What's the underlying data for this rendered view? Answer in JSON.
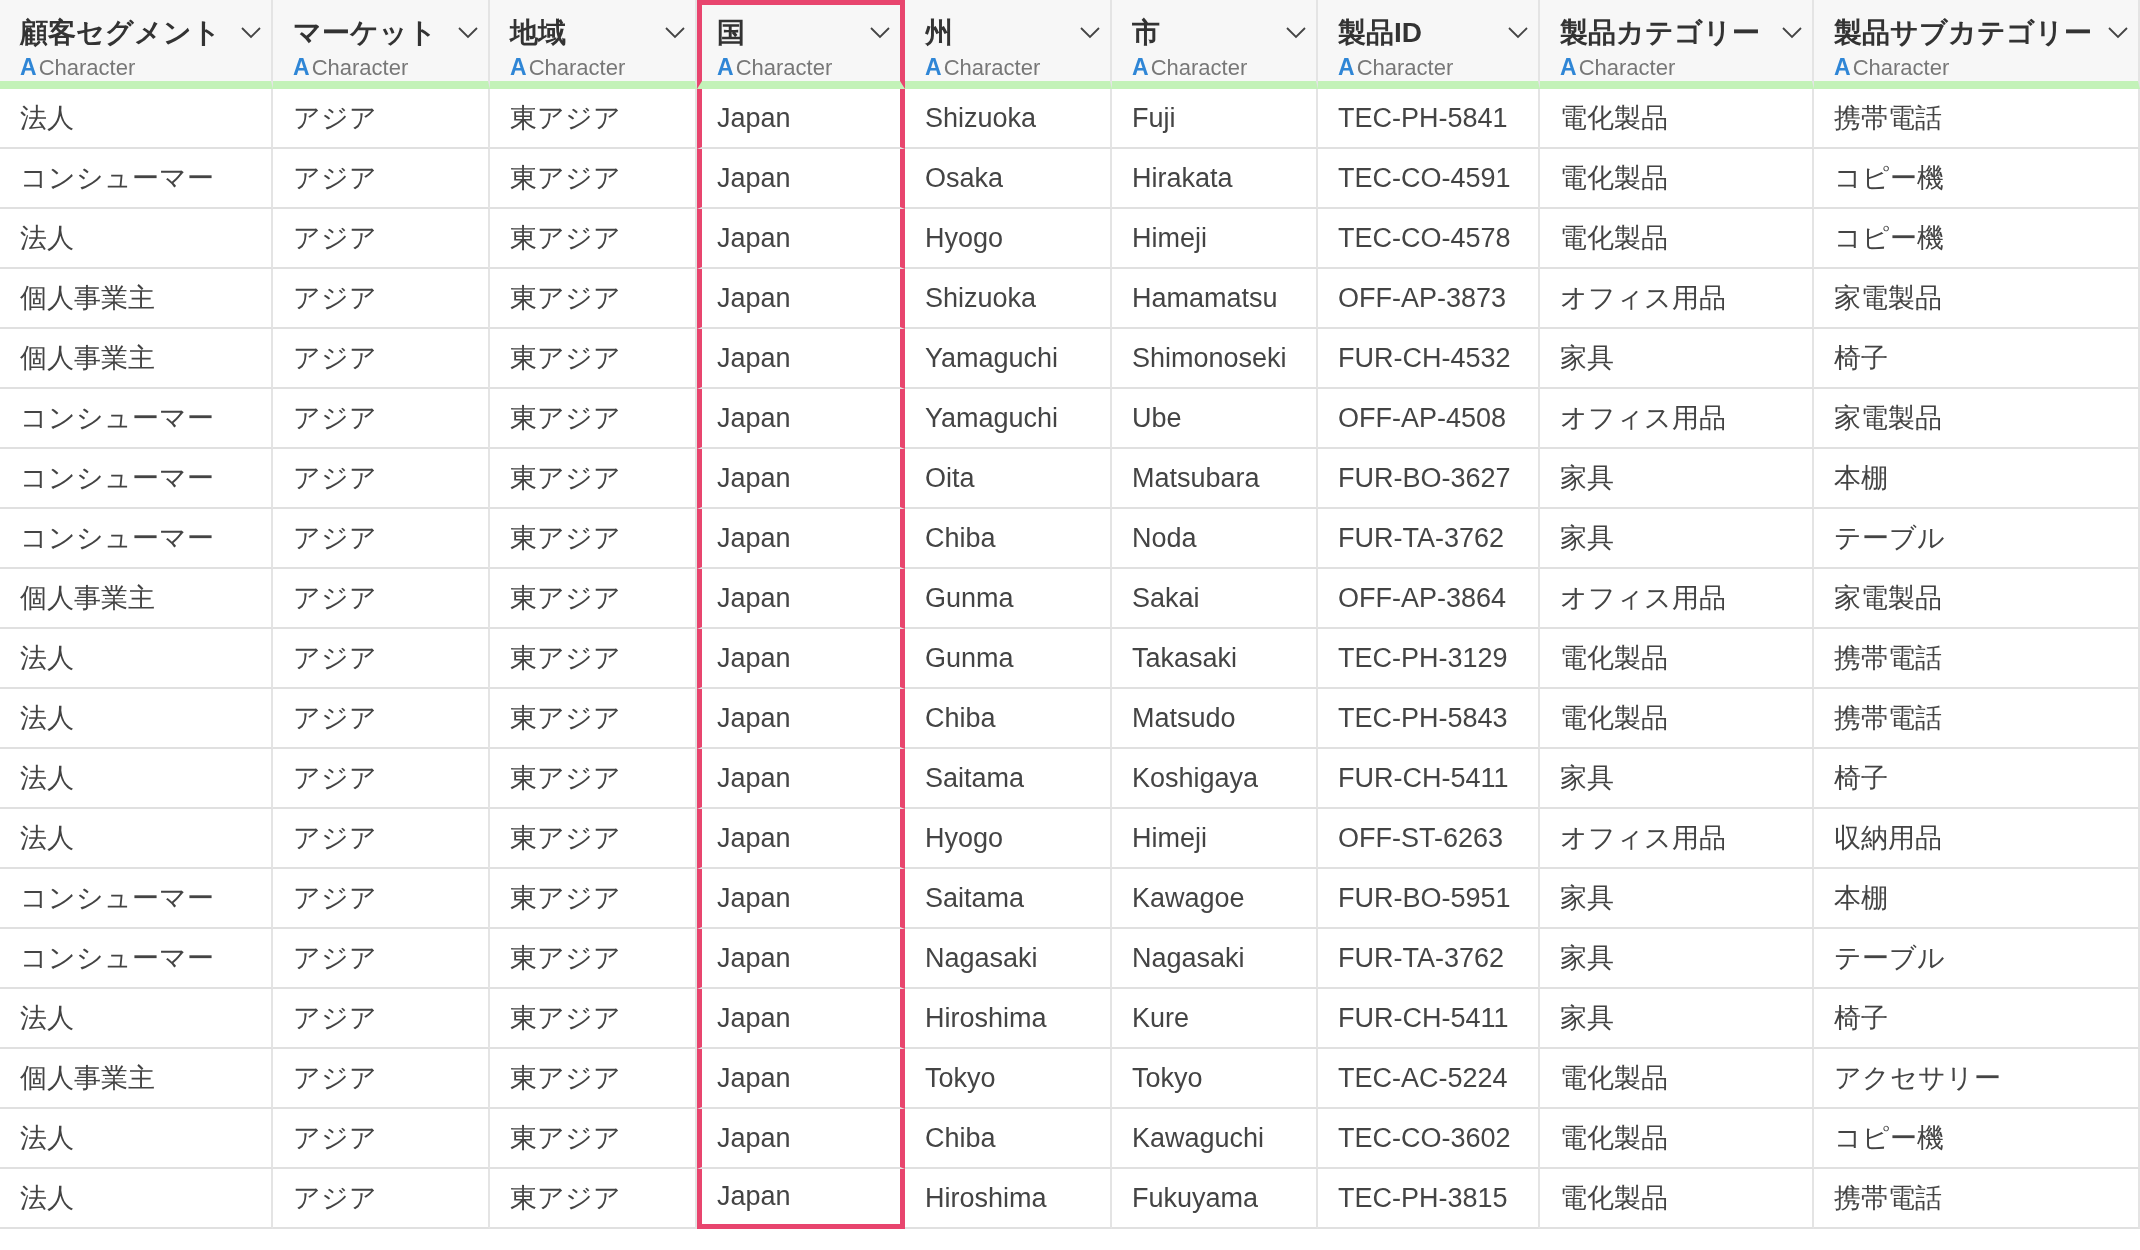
{
  "table": {
    "columns": [
      {
        "label": "顧客セグメント",
        "type_icon": "A",
        "type": "Character",
        "selected": false
      },
      {
        "label": "マーケット",
        "type_icon": "A",
        "type": "Character",
        "selected": false
      },
      {
        "label": "地域",
        "type_icon": "A",
        "type": "Character",
        "selected": false
      },
      {
        "label": "国",
        "type_icon": "A",
        "type": "Character",
        "selected": true
      },
      {
        "label": "州",
        "type_icon": "A",
        "type": "Character",
        "selected": false
      },
      {
        "label": "市",
        "type_icon": "A",
        "type": "Character",
        "selected": false
      },
      {
        "label": "製品ID",
        "type_icon": "A",
        "type": "Character",
        "selected": false
      },
      {
        "label": "製品カテゴリー",
        "type_icon": "A",
        "type": "Character",
        "selected": false
      },
      {
        "label": "製品サブカテゴリー",
        "type_icon": "A",
        "type": "Character",
        "selected": false
      }
    ],
    "rows": [
      [
        "法人",
        "アジア",
        "東アジア",
        "Japan",
        "Shizuoka",
        "Fuji",
        "TEC-PH-5841",
        "電化製品",
        "携帯電話"
      ],
      [
        "コンシューマー",
        "アジア",
        "東アジア",
        "Japan",
        "Osaka",
        "Hirakata",
        "TEC-CO-4591",
        "電化製品",
        "コピー機"
      ],
      [
        "法人",
        "アジア",
        "東アジア",
        "Japan",
        "Hyogo",
        "Himeji",
        "TEC-CO-4578",
        "電化製品",
        "コピー機"
      ],
      [
        "個人事業主",
        "アジア",
        "東アジア",
        "Japan",
        "Shizuoka",
        "Hamamatsu",
        "OFF-AP-3873",
        "オフィス用品",
        "家電製品"
      ],
      [
        "個人事業主",
        "アジア",
        "東アジア",
        "Japan",
        "Yamaguchi",
        "Shimonoseki",
        "FUR-CH-4532",
        "家具",
        "椅子"
      ],
      [
        "コンシューマー",
        "アジア",
        "東アジア",
        "Japan",
        "Yamaguchi",
        "Ube",
        "OFF-AP-4508",
        "オフィス用品",
        "家電製品"
      ],
      [
        "コンシューマー",
        "アジア",
        "東アジア",
        "Japan",
        "Oita",
        "Matsubara",
        "FUR-BO-3627",
        "家具",
        "本棚"
      ],
      [
        "コンシューマー",
        "アジア",
        "東アジア",
        "Japan",
        "Chiba",
        "Noda",
        "FUR-TA-3762",
        "家具",
        "テーブル"
      ],
      [
        "個人事業主",
        "アジア",
        "東アジア",
        "Japan",
        "Gunma",
        "Sakai",
        "OFF-AP-3864",
        "オフィス用品",
        "家電製品"
      ],
      [
        "法人",
        "アジア",
        "東アジア",
        "Japan",
        "Gunma",
        "Takasaki",
        "TEC-PH-3129",
        "電化製品",
        "携帯電話"
      ],
      [
        "法人",
        "アジア",
        "東アジア",
        "Japan",
        "Chiba",
        "Matsudo",
        "TEC-PH-5843",
        "電化製品",
        "携帯電話"
      ],
      [
        "法人",
        "アジア",
        "東アジア",
        "Japan",
        "Saitama",
        "Koshigaya",
        "FUR-CH-5411",
        "家具",
        "椅子"
      ],
      [
        "法人",
        "アジア",
        "東アジア",
        "Japan",
        "Hyogo",
        "Himeji",
        "OFF-ST-6263",
        "オフィス用品",
        "収納用品"
      ],
      [
        "コンシューマー",
        "アジア",
        "東アジア",
        "Japan",
        "Saitama",
        "Kawagoe",
        "FUR-BO-5951",
        "家具",
        "本棚"
      ],
      [
        "コンシューマー",
        "アジア",
        "東アジア",
        "Japan",
        "Nagasaki",
        "Nagasaki",
        "FUR-TA-3762",
        "家具",
        "テーブル"
      ],
      [
        "法人",
        "アジア",
        "東アジア",
        "Japan",
        "Hiroshima",
        "Kure",
        "FUR-CH-5411",
        "家具",
        "椅子"
      ],
      [
        "個人事業主",
        "アジア",
        "東アジア",
        "Japan",
        "Tokyo",
        "Tokyo",
        "TEC-AC-5224",
        "電化製品",
        "アクセサリー"
      ],
      [
        "法人",
        "アジア",
        "東アジア",
        "Japan",
        "Chiba",
        "Kawaguchi",
        "TEC-CO-3602",
        "電化製品",
        "コピー機"
      ],
      [
        "法人",
        "アジア",
        "東アジア",
        "Japan",
        "Hiroshima",
        "Fukuyama",
        "TEC-PH-3815",
        "電化製品",
        "携帯電話"
      ]
    ]
  }
}
